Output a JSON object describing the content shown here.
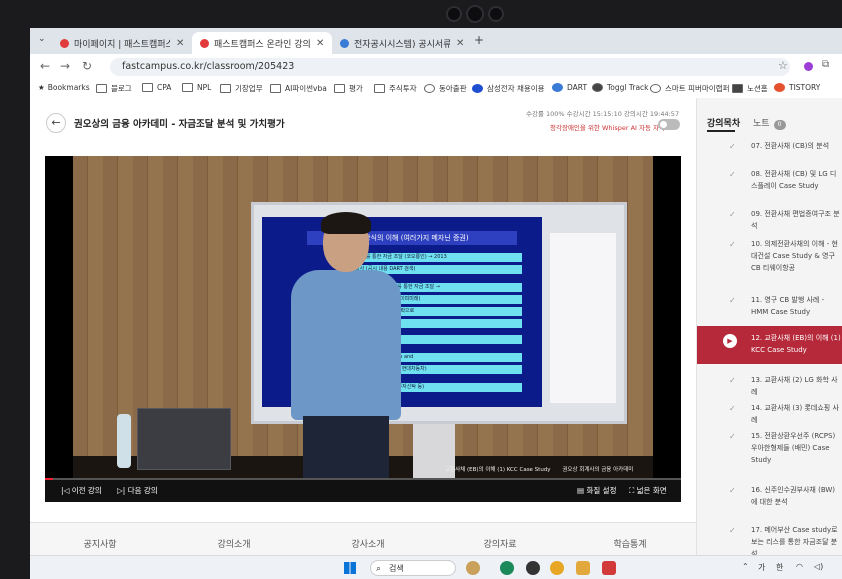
{
  "browser": {
    "tabs": [
      {
        "label": "마이페이지 | 패스트캠퍼스",
        "favicon_color": "#e23b3b"
      },
      {
        "label": "패스트캠퍼스 온라인 강의",
        "favicon_color": "#e23b3b"
      },
      {
        "label": "전자공시시스템) 공시서류검색",
        "favicon_color": "#3a7bd5"
      }
    ],
    "url": "fastcampus.co.kr/classroom/205423",
    "bookmarks": [
      "Bookmarks",
      "블로그",
      "CPA",
      "NPL",
      "기장업무",
      "AI파이썬vba",
      "평가",
      "주식투자",
      "동아출판",
      "삼성전자 채용이용",
      "DART",
      "Toggl Track",
      "스마트 피버마이랩퍼",
      "노션홈",
      "TISTORY"
    ]
  },
  "page": {
    "title": "권오상의 금융 아카데미 - 자금조달 분석 및 가치평가",
    "stats": "수강률 100%   수강시간 15:15:10   강의시간 19:44:57",
    "whisper": "청각장애인을 위한 Whisper AI 자동 자막"
  },
  "video": {
    "slide_title": "발 방식의 이해 (여러가지 메자닌 증권)",
    "slide_lines": [
      "(CB)를 통한 자금 조달 (코오롱인) → 2013",
      "행사 (공시 내용 DART 검색)",
      "ck Warrant : BW)를 통한 자금 조달 →",
      "요 효과 향상 고려 (케이피미래)",
      "Put option시 주가하락으로",
      "구 발행 Case)",
      "행 Case",
      "통한 자금 조달: Sales and",
      "축은행 Case, TRS의 현대차동차)",
      "초채 : ABS, 부동산 투자신탁 등)"
    ],
    "caption_left": "교환사채 (EB)의 이해 (1) KCC Case Study",
    "caption_right": "권오상 회계사의 금융 아카데미",
    "prev_label": "이전 강의",
    "next_label": "다음 강의",
    "settings_label": "화질 설정",
    "wide_label": "넓은 화면"
  },
  "page_tabs": [
    "공지사항",
    "강의소개",
    "강사소개",
    "강의자료",
    "학습통계"
  ],
  "panel": {
    "tab_curriculum": "강의목차",
    "tab_notes": "노트",
    "notes_count": "0",
    "items": [
      {
        "label": "07. 전환사채 (CB)의 분석"
      },
      {
        "label": "08. 전환사채 (CB) 및 LG 디스플레이 Case Study"
      },
      {
        "label": "09. 전환사채 편법증여구조 분석"
      },
      {
        "label": "10. 의제전환사채의 이해 - 현대건설 Case Study & 영구CB 티웨이항공"
      },
      {
        "label": "11. 영구 CB 발행 사례 - HMM Case Study"
      },
      {
        "label": "12. 교환사채 (EB)의 이해 (1) KCC Case Study"
      },
      {
        "label": "13. 교환사채 (2) LG 화학 사례"
      },
      {
        "label": "14. 교환사채 (3) 롯데쇼핑 사례"
      },
      {
        "label": "15. 전환상환우선주 (RCPS) 우아한형제들 (배민) Case Study"
      },
      {
        "label": "16. 신주인수권부사채 (BW)에 대한 분석"
      },
      {
        "label": "17. 메어부산 Case study로 보는 리스를 통한 자금조달 분석"
      }
    ]
  },
  "taskbar": {
    "search": "검색",
    "lang1": "가",
    "lang2": "한"
  }
}
